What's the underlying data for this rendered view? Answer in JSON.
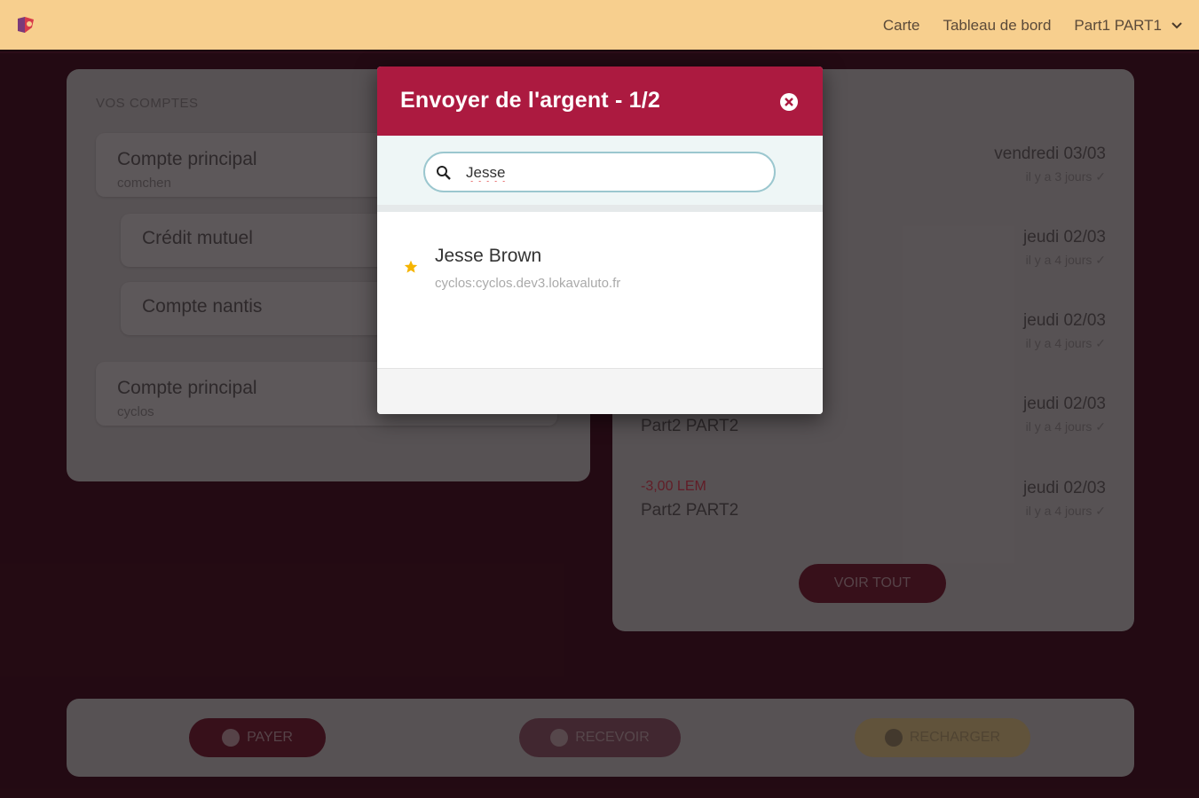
{
  "header": {
    "nav": {
      "map": "Carte",
      "dashboard": "Tableau de bord",
      "user": "Part1 PART1"
    }
  },
  "accounts": {
    "title": "VOS COMPTES",
    "items": [
      {
        "name": "Compte principal",
        "sub": "comchen"
      },
      {
        "name": "Crédit mutuel",
        "sub": ""
      },
      {
        "name": "Compte nantis",
        "sub": ""
      },
      {
        "name": "Compte principal",
        "sub": "cyclos"
      }
    ]
  },
  "transactions": {
    "items": [
      {
        "amount": "",
        "who": "",
        "date": "vendredi 03/03",
        "ago": "il y a 3 jours"
      },
      {
        "amount": "",
        "who": "",
        "date": "jeudi 02/03",
        "ago": "il y a 4 jours"
      },
      {
        "amount": "",
        "who": "",
        "date": "jeudi 02/03",
        "ago": "il y a 4 jours"
      },
      {
        "amount": "",
        "who": "Part2 PART2",
        "date": "jeudi 02/03",
        "ago": "il y a 4 jours"
      },
      {
        "amount": "-3,00 LEM",
        "who": "Part2 PART2",
        "date": "jeudi 02/03",
        "ago": "il y a 4 jours"
      }
    ],
    "see_all": "VOIR TOUT"
  },
  "actions": {
    "pay": "PAYER",
    "receive": "RECEVOIR",
    "recharge": "RECHARGER"
  },
  "modal": {
    "title": "Envoyer de l'argent - 1/2",
    "search_value": "Jesse",
    "result": {
      "name": "Jesse Brown",
      "sub": "cyclos:cyclos.dev3.lokavaluto.fr"
    }
  },
  "colors": {
    "header_bg": "#f7cf8e",
    "brand": "#ac1a40",
    "star": "#f5b400",
    "pay_btn": "#4a1622",
    "recharge_btn": "#8a7d55"
  },
  "icons": {
    "logo": "app-logo-icon",
    "chevron": "chevron-down-icon",
    "close": "close-icon",
    "search": "search-icon",
    "star": "star-icon",
    "check": "check-icon"
  }
}
